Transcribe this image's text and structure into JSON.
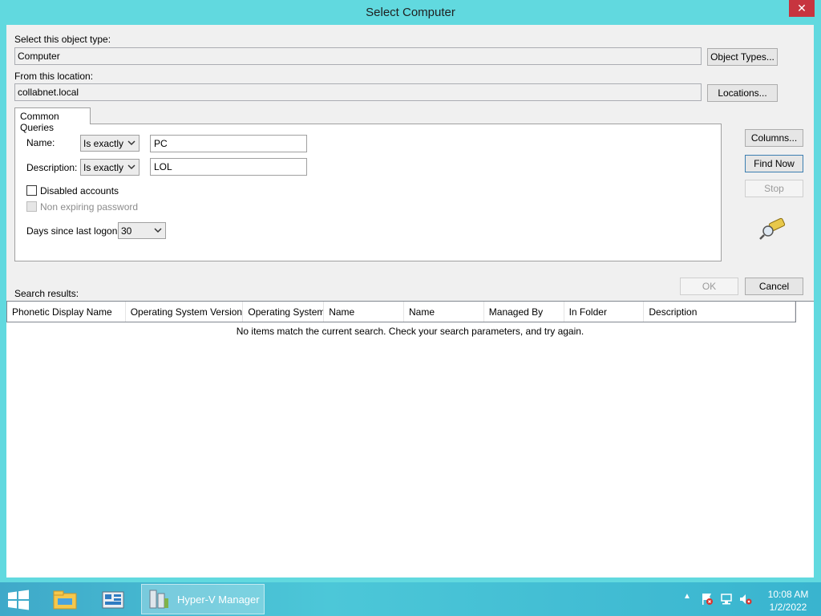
{
  "window": {
    "title": "Select Computer",
    "close_label": "✕"
  },
  "object_type": {
    "label": "Select this object type:",
    "value": "Computer",
    "button": "Object Types..."
  },
  "location": {
    "label": "From this location:",
    "value": "collabnet.local",
    "button": "Locations..."
  },
  "tabs": [
    {
      "label": "Common Queries"
    }
  ],
  "query": {
    "name_label": "Name:",
    "name_op": "Is exactly",
    "name_value": "PC",
    "desc_label": "Description:",
    "desc_op": "Is exactly",
    "desc_value": "LOL",
    "disabled_accounts": "Disabled accounts",
    "non_expiring": "Non expiring password",
    "days_label": "Days since last logon:",
    "days_value": "30"
  },
  "buttons": {
    "columns": "Columns...",
    "find_now": "Find Now",
    "stop": "Stop",
    "ok": "OK",
    "cancel": "Cancel"
  },
  "results": {
    "label": "Search results:",
    "columns": [
      "Phonetic Display Name",
      "Operating System Version",
      "Operating System",
      "Name",
      "Name",
      "Managed By",
      "In Folder",
      "Description"
    ],
    "empty_message": "No items match the current search. Check your search parameters, and try again."
  },
  "taskbar": {
    "active_app": "Hyper-V Manager",
    "time": "10:08 AM",
    "date": "1/2/2022"
  },
  "colors": {
    "accent": "#61d9df",
    "close": "#c7343f",
    "taskbar": "#3fa9c9"
  }
}
